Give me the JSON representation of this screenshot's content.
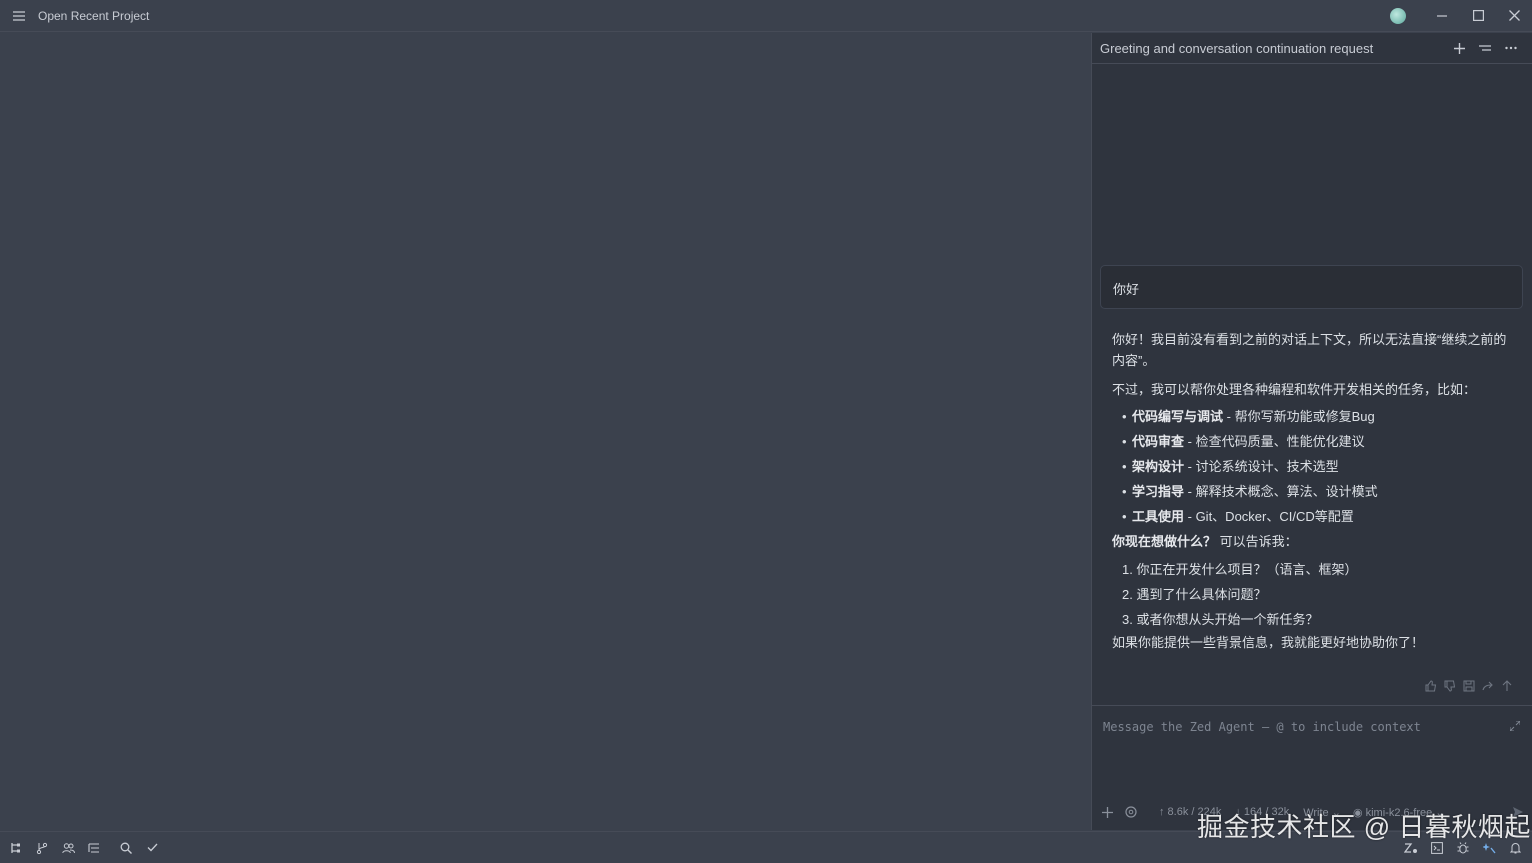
{
  "titlebar": {
    "project_label": "Open Recent Project"
  },
  "agent_panel": {
    "thread_title": "Greeting and conversation continuation request",
    "user_message": "你好",
    "reply": {
      "intro": "你好！我目前没有看到之前的对话上下文，所以无法直接“继续之前的内容”。",
      "offer": "不过，我可以帮你处理各种编程和软件开发相关的任务，比如：",
      "bullets": [
        {
          "title": "代码编写与调试",
          "desc": " - 帮你写新功能或修复Bug"
        },
        {
          "title": "代码审查",
          "desc": " - 检查代码质量、性能优化建议"
        },
        {
          "title": "架构设计",
          "desc": " - 讨论系统设计、技术选型"
        },
        {
          "title": "学习指导",
          "desc": " - 解释技术概念、算法、设计模式"
        },
        {
          "title": "工具使用",
          "desc": " - Git、Docker、CI/CD等配置"
        }
      ],
      "question_bold": "你现在想做什么？",
      "question_rest": " 可以告诉我：",
      "numbered": [
        "1. 你正在开发什么项目？（语言、框架）",
        "2. 遇到了什么具体问题？",
        "3. 或者你想从头开始一个新任务？"
      ],
      "closing": "如果你能提供一些背景信息，我就能更好地协助你了！"
    },
    "composer": {
      "placeholder": "Message the Zed Agent — @ to include context",
      "tokens_up": "↑ 8.6k / 224k",
      "tokens_down": "↓ 164 / 32k",
      "mode": "Write",
      "model": "kimi-k2.6-free"
    }
  },
  "watermark": "掘金技术社区 @ 日暮秋烟起",
  "colors": {
    "accent": "#74ade8",
    "background": "#3b414d",
    "panel": "#2f343e"
  }
}
